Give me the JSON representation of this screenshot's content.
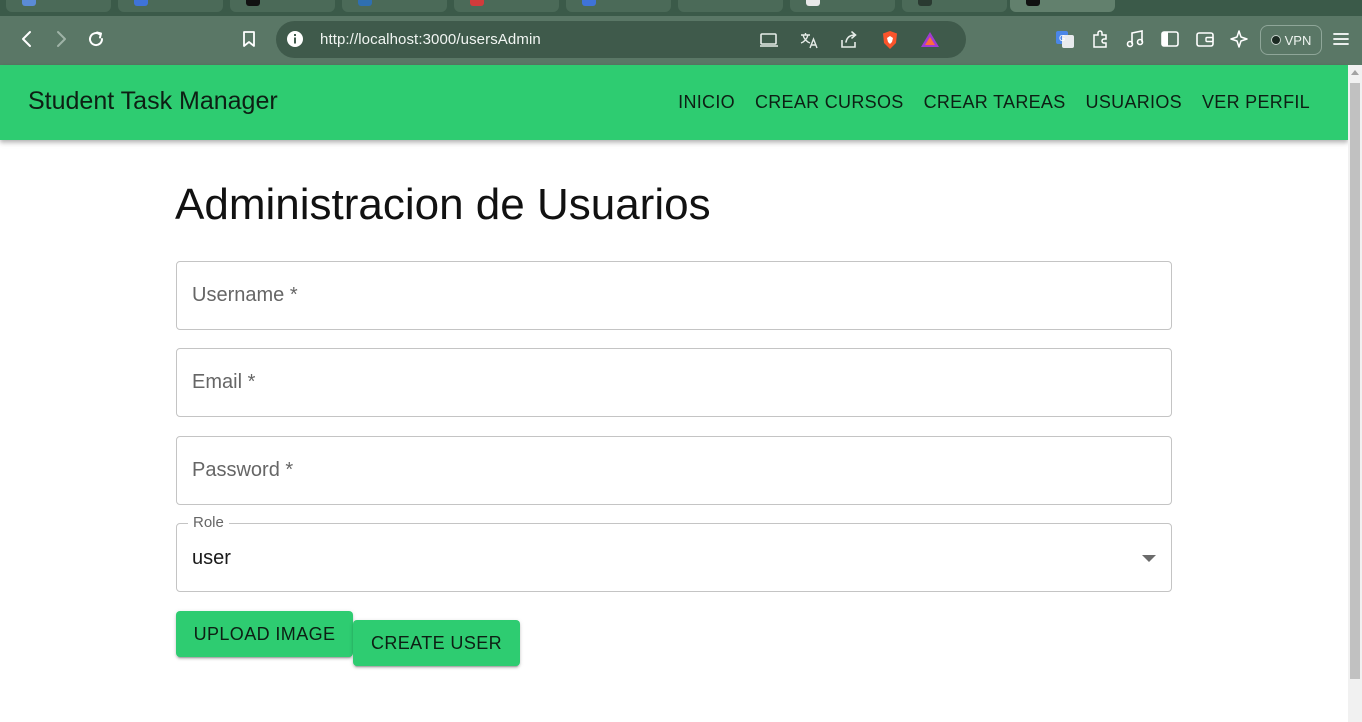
{
  "browser": {
    "url": "http://localhost:3000/usersAdmin",
    "vpn_label": "VPN"
  },
  "app": {
    "brand": "Student Task Manager",
    "nav": [
      "INICIO",
      "CREAR CURSOS",
      "CREAR TAREAS",
      "USUARIOS",
      "VER PERFIL"
    ],
    "accent_color": "#2ecc71"
  },
  "page": {
    "title": "Administracion de Usuarios"
  },
  "form": {
    "username_placeholder": "Username *",
    "email_placeholder": "Email *",
    "password_placeholder": "Password *",
    "role_label": "Role",
    "role_value": "user",
    "upload_button": "UPLOAD IMAGE",
    "create_button": "CREATE USER"
  }
}
